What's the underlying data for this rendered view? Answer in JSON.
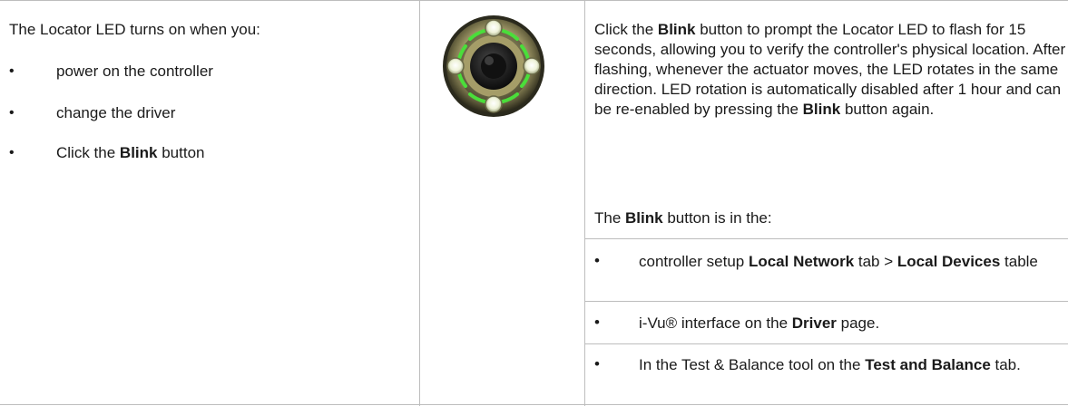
{
  "left": {
    "intro": "The Locator LED turns on when you:",
    "bullet_glyph": "•",
    "items": [
      {
        "text": "power on the controller"
      },
      {
        "text": "change the driver"
      },
      {
        "pre": "Click the ",
        "bold": "Blink",
        "post": " button"
      }
    ]
  },
  "image": {
    "icon": "locator-led-ring",
    "colors": {
      "ring": "#c9c08a",
      "led_white": "#f4f6e6",
      "led_green": "#4ade3a",
      "center": "#1c1c1c"
    }
  },
  "right": {
    "para1": [
      {
        "t": "Click the "
      },
      {
        "t": "Blink",
        "b": true
      },
      {
        "t": " button to prompt the Locator LED to flash for 15 seconds, allowing you to verify the controller's physical location. After flashing, whenever the actuator moves, the LED rotates in the same direction. LED rotation is automatically disabled after 1 hour and can be re-enabled by pressing the "
      },
      {
        "t": "Blink",
        "b": true
      },
      {
        "t": " button again."
      }
    ],
    "para2": [
      {
        "t": "The "
      },
      {
        "t": "Blink",
        "b": true
      },
      {
        "t": " button is in the:"
      }
    ],
    "bullets": [
      [
        {
          "t": "controller setup "
        },
        {
          "t": "Local Network",
          "b": true
        },
        {
          "t": " tab > "
        },
        {
          "t": "Local Devices",
          "b": true
        },
        {
          "t": " table"
        }
      ],
      [
        {
          "t": "i-Vu® interface on the "
        },
        {
          "t": "Driver",
          "b": true
        },
        {
          "t": " page."
        }
      ],
      [
        {
          "t": "In the Test & Balance tool on the "
        },
        {
          "t": "Test and Balance",
          "b": true
        },
        {
          "t": " tab."
        }
      ]
    ]
  }
}
